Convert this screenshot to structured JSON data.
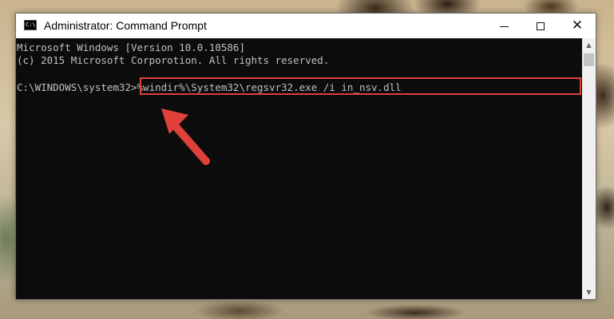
{
  "window": {
    "title": "Administrator: Command Prompt",
    "icon": "cmd-icon",
    "icon_text": "C:\\",
    "controls": {
      "minimize_icon": "minimize-icon",
      "maximize_icon": "maximize-icon",
      "close_icon": "close-icon"
    }
  },
  "console": {
    "lines": [
      "Microsoft Windows [Version 10.0.10586]",
      "(c) 2015 Microsoft Corporotion. All rights reserved."
    ],
    "prompt": "C:\\WINDOWS\\system32>",
    "command": "%windir%\\System32\\regsvr32.exe /i in_nsv.dll"
  },
  "annotation": {
    "highlight_color": "#e0403a",
    "arrow_color": "#e0403a",
    "arrow_icon": "pointer-arrow-icon"
  },
  "colors": {
    "console_bg": "#0c0c0c",
    "console_text": "#c0c0c0"
  }
}
